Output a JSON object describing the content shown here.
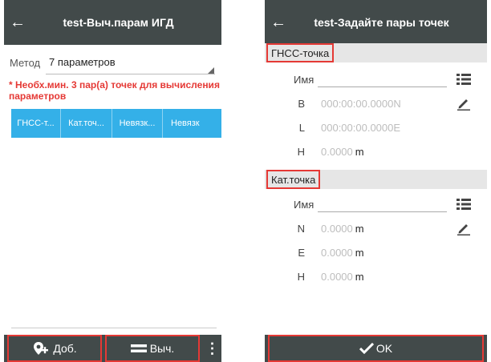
{
  "left": {
    "title": "test-Выч.парам ИГД",
    "method_label": "Метод",
    "method_value": "7 параметров",
    "warning": "* Необх.мин. 3 пар(а) точек для вычисления параметров",
    "columns": [
      "ГНСС-т...",
      "Кат.точ...",
      "Невязк...",
      "Невязк"
    ],
    "add_label": "Доб.",
    "calc_label": "Выч.",
    "more_label": "⋮"
  },
  "right": {
    "title": "test-Задайте пары точек",
    "gnss_section": "ГНСС-точка",
    "gnss_name_label": "Имя",
    "gnss_rows": [
      {
        "key": "B",
        "value": "000:00:00.0000N",
        "unit": ""
      },
      {
        "key": "L",
        "value": "000:00:00.0000E",
        "unit": ""
      },
      {
        "key": "H",
        "value": "0.0000",
        "unit": "m"
      }
    ],
    "cat_section": "Кат.точка",
    "cat_name_label": "Имя",
    "cat_rows": [
      {
        "key": "N",
        "value": "0.0000",
        "unit": "m"
      },
      {
        "key": "E",
        "value": "0.0000",
        "unit": "m"
      },
      {
        "key": "H",
        "value": "0.0000",
        "unit": "m"
      }
    ],
    "ok_label": "OK"
  }
}
